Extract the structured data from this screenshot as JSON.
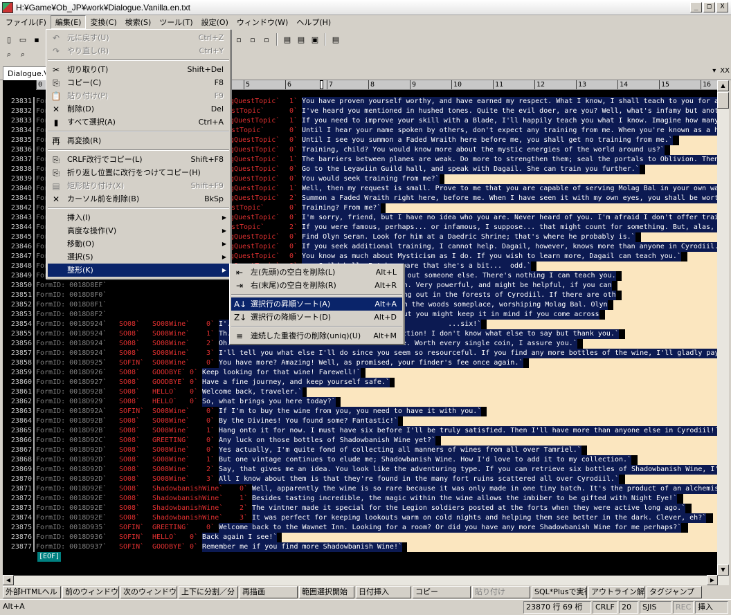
{
  "window": {
    "title": "H:¥Game¥Ob_JP¥work¥Dialogue.Vanilla.en.txt",
    "minimize": "_",
    "maximize": "□",
    "close": "X"
  },
  "menubar": [
    "ファイル(F)",
    "編集(E)",
    "変換(C)",
    "検索(S)",
    "ツール(T)",
    "設定(O)",
    "ウィンドウ(W)",
    "ヘルプ(H)"
  ],
  "tab": {
    "label": "Dialogue.Vanilla.en.txt",
    "dropdown": "▾",
    "close": "XX"
  },
  "ruler": [
    {
      "col": "0"
    },
    {
      "col": "1"
    },
    {
      "col": "2"
    },
    {
      "col": "3"
    },
    {
      "col": "4"
    },
    {
      "col": "5"
    },
    {
      "col": "6"
    },
    {
      "col": "7"
    },
    {
      "col": "8"
    },
    {
      "col": "9"
    },
    {
      "col": "10"
    },
    {
      "col": "11"
    },
    {
      "col": "12"
    },
    {
      "col": "13"
    },
    {
      "col": "14"
    },
    {
      "col": "15"
    },
    {
      "col": "16"
    }
  ],
  "lines": [
    {
      "n": "23831",
      "fid": "FormID: 0018D8E3`",
      "topic": "gQuestTopic`",
      "idx": "1`",
      "text": "You have proven yourself worthy, and have earned my respect. What I know, I shall teach to you for a"
    },
    {
      "n": "23832",
      "fid": "FormID: 0018D8E4`",
      "topic": "stTopic`",
      "idx": "0`",
      "text": "I've heard you mentioned in hushed tones. Quite the evil doer, are you? Well, what's infamy but another"
    },
    {
      "n": "23833",
      "fid": "FormID: 0018D8E5`",
      "topic": "gQuestTopic`",
      "idx": "1`",
      "text": "If you need to improve your skill with a Blade, I'll happily teach you what I know. Imagine how many peo"
    },
    {
      "n": "23834",
      "fid": "FormID: 0018D8E6`",
      "topic": "stTopic`",
      "idx": "0`",
      "text": "Until I hear your name spoken by others, don't expect any training from me. When you're known as a hero"
    },
    {
      "n": "23835",
      "fid": "FormID: 0018D8E7`",
      "topic": "gQuestTopic`",
      "idx": "0`",
      "text": "Until I see you summon a Faded Wraith here before me, you shall get no training from me.`"
    },
    {
      "n": "23836",
      "fid": "FormID: 0018D8E8`",
      "topic": "gQuestTopic`",
      "idx": "0`",
      "text": "Training, child? You would know more about the mystic energies of the world around us?`"
    },
    {
      "n": "23837",
      "fid": "FormID: 0018D8E9`",
      "topic": "gQuestTopic`",
      "idx": "1`",
      "text": "The barriers between planes are weak. Do more to strengthen them; seal the portals to Oblivion. Then"
    },
    {
      "n": "23838",
      "fid": "FormID: 0018D8EA`",
      "topic": "gQuestTopic`",
      "idx": "0`",
      "text": "Go to the Leyawiin Guild hall, and speak with Dagail. She can train you further.`"
    },
    {
      "n": "23839",
      "fid": "FormID: 0018D8EB`",
      "topic": "gQuestTopic`",
      "idx": "0`",
      "text": "You would seek training from me?`"
    },
    {
      "n": "23840",
      "fid": "FormID: 0018D8EC`",
      "topic": "gQuestTopic`",
      "idx": "1`",
      "text": "Well, then my request is small. Prove to me that you are capable of serving Molag Bal in your own wa"
    },
    {
      "n": "23841",
      "fid": "FormID: 0018D8ED`",
      "topic": "gQuestTopic`",
      "idx": "2`",
      "text": "Summon a Faded Wraith right here, before me. When I have seen it with my own eyes, you shall be wort"
    },
    {
      "n": "23842",
      "fid": "FormID: 0018D8EE`",
      "topic": "stTopic`",
      "idx": "0`",
      "text": "Training? From me?`"
    },
    {
      "n": "23843",
      "fid": "FormID: 0018D8EF`",
      "topic": "gQuestTopic`",
      "idx": "0`",
      "text": "I'm sorry, friend, but I have no idea who you are. Never heard of you. I'm afraid I don't offer training"
    },
    {
      "n": "23844",
      "fid": "FormID: 0018D8F0`",
      "topic": "stTopic`",
      "idx": "2`",
      "text": "If you were famous, perhaps... or infamous, I suppose... that might count for something. But, alas, you'"
    },
    {
      "n": "23845",
      "fid": "FormID: 0018D8F1`",
      "topic": "gQuestTopic`",
      "idx": "0`",
      "text": "Find Olyn Seran. Look for him at a Daedric Shrine; that's where he probably is.`"
    },
    {
      "n": "23846",
      "fid": "FormID: 0018D8F2`",
      "topic": "gQuestTopic`",
      "idx": "0`",
      "text": "If you seek additional training, I cannot help. Dagail, however, knows more than anyone in Cyrodiil."
    },
    {
      "n": "23847",
      "fid": "FormID: 0018D8F3`",
      "topic": "gQuestTopic`",
      "idx": "0`",
      "text": "You know as much about Mysticism as I do. If you wish to learn more, Dagail can teach you.`"
    },
    {
      "n": "23848",
      "fid": "FormID: 0018D8F4`",
      "topic": "gQuestTopic`",
      "idx": "0`",
      "text": "... Guild hall. But be aware that she's a bit...  odd.`"
    },
    {
      "n": "23849",
      "fid": "FormID: 0018D8F5`",
      "topic": "TrainingConjuration`Trai",
      "idx": "",
      "text": "...ther, you'll have to seek out someone else. There's nothing I can teach you."
    },
    {
      "n": "23850",
      "fid": "FormID: 0018D8EF`",
      "topic": "TrainingConjuration`Trai",
      "idx": "",
      "text": "...orshipper named Olyn Seran. Very powerful, and might be helpful, if you can"
    },
    {
      "n": "23851",
      "fid": "FormID: 0018D8F0`",
      "topic": "TrainingConjuration`Trai",
      "idx": "",
      "text": "...orrowind, and is now hiding out in the forests of Cyrodiil. If there are oth"
    },
    {
      "n": "23852",
      "fid": "FormID: 0018D8F1`",
      "topic": "TrainingConjuration`Trai",
      "idx": "",
      "text": "...a powerful conjurer off in the woods someplace, worshiping Molag Bal. Olyn"
    },
    {
      "n": "23853",
      "fid": "FormID: 0018D8F2`",
      "topic": "TrainingConjuration`Trai",
      "idx": "",
      "text": "...looking for him myself, but you might keep it in mind if you come across"
    },
    {
      "n": "23854",
      "fid": "FormID: 0018D924`",
      "topic": "SO08`",
      "topic2": "SO08Wine`",
      "idx": "0`",
      "text": "I'...                                                  ...six!`"
    },
    {
      "n": "23855",
      "fid": "FormID: 0018D924`",
      "topic": "SO08`",
      "topic2": "SO08Wine`",
      "idx": "1`",
      "text": "Th...                                    ...ction! I don't know what else to say but thank you.`"
    },
    {
      "n": "23856",
      "fid": "FormID: 0018D924`",
      "topic": "SO08`",
      "topic2": "SO08Wine`",
      "idx": "2`",
      "text": "Oh...                                    ...e. Worth every single coin, I assure you.`"
    },
    {
      "n": "23857",
      "fid": "FormID: 0018D924`",
      "topic": "SO08`",
      "topic2": "SO08Wine`",
      "idx": "3`",
      "text": "I'll tell you what else I'll do since you seem so resourceful. If you find any more bottles of the wine, I'll gladly pay"
    },
    {
      "n": "23858",
      "fid": "FormID: 0018D925`",
      "topic": "SOFIN`",
      "topic2": "SO08Wine`",
      "idx": "0`",
      "text": "You have more? Amazing! Well, as promised, your finder's fee once again.`"
    },
    {
      "n": "23859",
      "fid": "FormID: 0018D926`",
      "topic": "SO08`",
      "topic2": "GOODBYE`",
      "idx": "0`",
      "text": "Keep looking for that wine! Farewell!`"
    },
    {
      "n": "23860",
      "fid": "FormID: 0018D927`",
      "topic": "SO08`",
      "topic2": "GOODBYE`",
      "idx": "0`",
      "text": "Have a fine journey, and keep yourself safe.`"
    },
    {
      "n": "23861",
      "fid": "FormID: 0018D928`",
      "topic": "SO08`",
      "topic2": "HELLO`",
      "idx": "0`",
      "text": "Welcome back, traveler.`"
    },
    {
      "n": "23862",
      "fid": "FormID: 0018D929`",
      "topic": "SO08`",
      "topic2": "HELLO`",
      "idx": "0`",
      "text": "So, what brings you here today?`"
    },
    {
      "n": "23863",
      "fid": "FormID: 0018D92A`",
      "topic": "SOFIN`",
      "topic2": "SO08Wine`",
      "idx": "0`",
      "text": "If I'm to buy the wine from you, you need to have it with you.`"
    },
    {
      "n": "23864",
      "fid": "FormID: 0018D92B`",
      "topic": "SO08`",
      "topic2": "SO08Wine`",
      "idx": "0`",
      "text": "By the Divines! You found some? Fantastic!`"
    },
    {
      "n": "23865",
      "fid": "FormID: 0018D92B`",
      "topic": "SO08`",
      "topic2": "SO08Wine`",
      "idx": "1`",
      "text": "Hang onto it for now. I must have six before I'll be truly satisfied. Then I'll have more than anyone else in Cyrodiil!`"
    },
    {
      "n": "23866",
      "fid": "FormID: 0018D92C`",
      "topic": "SO08`",
      "topic2": "GREETING`",
      "idx": "0`",
      "text": "Any luck on those bottles of Shadowbanish Wine yet?`"
    },
    {
      "n": "23867",
      "fid": "FormID: 0018D92D`",
      "topic": "SO08`",
      "topic2": "SO08Wine`",
      "idx": "0`",
      "text": "Yes actually, I'm quite fond of collecting all manners of wines from all over Tamriel.`"
    },
    {
      "n": "23868",
      "fid": "FormID: 0018D92D`",
      "topic": "SO08`",
      "topic2": "SO08Wine`",
      "idx": "1`",
      "text": "But one vintage continues to elude me; Shadowbanish Wine. How I'd love to add it to my collection.`"
    },
    {
      "n": "23869",
      "fid": "FormID: 0018D92D`",
      "topic": "SO08`",
      "topic2": "SO08Wine`",
      "idx": "2`",
      "text": "Say, that gives me an idea. You look like the adventuring type. If you can retrieve six bottles of Shadowbanish Wine, I'"
    },
    {
      "n": "23870",
      "fid": "FormID: 0018D92D`",
      "topic": "SO08`",
      "topic2": "SO08Wine`",
      "idx": "3`",
      "text": "All I know about them is that they're found in the many fort ruins scattered all over Cyrodiil.`"
    },
    {
      "n": "23871",
      "fid": "FormID: 0018D92E`",
      "topic": "SO08`",
      "topic2": "ShadowbanishWine`",
      "idx": "0`",
      "text": "Well, apparently the wine is so rare because it was only made in one tiny batch. It's the product of an alchemis"
    },
    {
      "n": "23872",
      "fid": "FormID: 0018D92E`",
      "topic": "SO08`",
      "topic2": "ShadowbanishWine`",
      "idx": "1`",
      "text": "Besides tasting incredible, the magic within the wine allows the imbiber to be gifted with Night Eye!`"
    },
    {
      "n": "23873",
      "fid": "FormID: 0018D92E`",
      "topic": "SO08`",
      "topic2": "ShadowbanishWine`",
      "idx": "2`",
      "text": "The vintner made it special for the Legion soldiers posted at the forts when they were active long ago.`"
    },
    {
      "n": "23874",
      "fid": "FormID: 0018D92E`",
      "topic": "SO08`",
      "topic2": "ShadowbanishWine`",
      "idx": "3`",
      "text": "It was perfect for keeping lookouts warm on cold nights and helping them see better in the dark. Clever, eh?`"
    },
    {
      "n": "23875",
      "fid": "FormID: 0018D935`",
      "topic": "SOFIN`",
      "topic2": "GREETING`",
      "idx": "0`",
      "text": "Welcome back to the Wawnet Inn. Looking for a room? Or did you have any more Shadowbanish Wine for me perhaps?`"
    },
    {
      "n": "23876",
      "fid": "FormID: 0018D936`",
      "topic": "SOFIN`",
      "topic2": "HELLO`",
      "idx": "0`",
      "text": "Back again I see!`"
    },
    {
      "n": "23877",
      "fid": "FormID: 0018D937`",
      "topic": "SOFIN`",
      "topic2": "GOODBYE`",
      "idx": "0`",
      "text": "Remember me if you find more Shadowbanish Wine!`"
    }
  ],
  "eof": "[EOF]",
  "edit_menu": [
    {
      "type": "item",
      "icon": "↶",
      "label": "元に戻す(U)",
      "shortcut": "Ctrl+Z",
      "disabled": true
    },
    {
      "type": "item",
      "icon": "↷",
      "label": "やり直し(R)",
      "shortcut": "Ctrl+Y",
      "disabled": true
    },
    {
      "type": "sep"
    },
    {
      "type": "item",
      "icon": "✂",
      "label": "切り取り(T)",
      "shortcut": "Shift+Del",
      "disabled": false
    },
    {
      "type": "item",
      "icon": "⎘",
      "label": "コピー(C)",
      "shortcut": "F8",
      "disabled": false
    },
    {
      "type": "item",
      "icon": "📋",
      "label": "貼り付け(P)",
      "shortcut": "F9",
      "disabled": true
    },
    {
      "type": "item",
      "icon": "✕",
      "label": "削除(D)",
      "shortcut": "Del",
      "disabled": false
    },
    {
      "type": "item",
      "icon": "▮",
      "label": "すべて選択(A)",
      "shortcut": "Ctrl+A",
      "disabled": false
    },
    {
      "type": "sep"
    },
    {
      "type": "item",
      "icon": "再",
      "label": "再変換(R)",
      "shortcut": "",
      "disabled": false
    },
    {
      "type": "sep"
    },
    {
      "type": "item",
      "icon": "⎘",
      "label": "CRLF改行でコピー(L)",
      "shortcut": "Shift+F8",
      "disabled": false
    },
    {
      "type": "item",
      "icon": "⎘",
      "label": "折り返し位置に改行をつけてコピー(H)",
      "shortcut": "",
      "disabled": false
    },
    {
      "type": "item",
      "icon": "▤",
      "label": "矩形貼り付け(X)",
      "shortcut": "Shift+F9",
      "disabled": true
    },
    {
      "type": "item",
      "icon": "✕",
      "label": "カーソル前を削除(B)",
      "shortcut": "BkSp",
      "disabled": false
    },
    {
      "type": "sep"
    },
    {
      "type": "sub",
      "label": "挿入(I)",
      "arrow": "▶"
    },
    {
      "type": "sub",
      "label": "高度な操作(V)",
      "arrow": "▶"
    },
    {
      "type": "sub",
      "label": "移動(O)",
      "arrow": "▶"
    },
    {
      "type": "sub",
      "label": "選択(S)",
      "arrow": "▶"
    },
    {
      "type": "sub",
      "label": "整形(K)",
      "arrow": "▶",
      "highlight": true
    }
  ],
  "format_menu": [
    {
      "type": "item",
      "icon": "⇤",
      "label": "左(先頭)の空白を削除(L)",
      "shortcut": "Alt+L"
    },
    {
      "type": "item",
      "icon": "⇥",
      "label": "右(末尾)の空白を削除(R)",
      "shortcut": "Alt+R"
    },
    {
      "type": "sep"
    },
    {
      "type": "item",
      "icon": "A↓",
      "label": "選択行の昇順ソート(A)",
      "shortcut": "Alt+A",
      "highlight": true
    },
    {
      "type": "item",
      "icon": "Z↓",
      "label": "選択行の降順ソート(D)",
      "shortcut": "Alt+D"
    },
    {
      "type": "sep"
    },
    {
      "type": "item",
      "icon": "≡",
      "label": "連続した重複行の削除(uniq)(U)",
      "shortcut": "Alt+M"
    }
  ],
  "fkeys": [
    {
      "label": "外部HTMLヘル",
      "disabled": false
    },
    {
      "label": "前のウィンドウ",
      "disabled": false
    },
    {
      "label": "次のウィンドウ",
      "disabled": false
    },
    {
      "label": "上下に分割／分",
      "disabled": false
    },
    {
      "label": "再描画",
      "disabled": false
    },
    {
      "label": "範囲選択開始",
      "disabled": false
    },
    {
      "label": "日付挿入",
      "disabled": false
    },
    {
      "label": "コピー",
      "disabled": false
    },
    {
      "label": "貼り付け",
      "disabled": true
    },
    {
      "label": "SQL*Plusで実行",
      "disabled": false
    },
    {
      "label": "アウトライン解析",
      "disabled": false
    },
    {
      "label": "タグジャンプ",
      "disabled": false
    }
  ],
  "status": {
    "hint": "Alt+A",
    "pos": "23870 行  69 桁",
    "crlf": "CRLF",
    "num": "20",
    "enc": "SJIS",
    "rec": "REC",
    "ins": "挿入"
  }
}
